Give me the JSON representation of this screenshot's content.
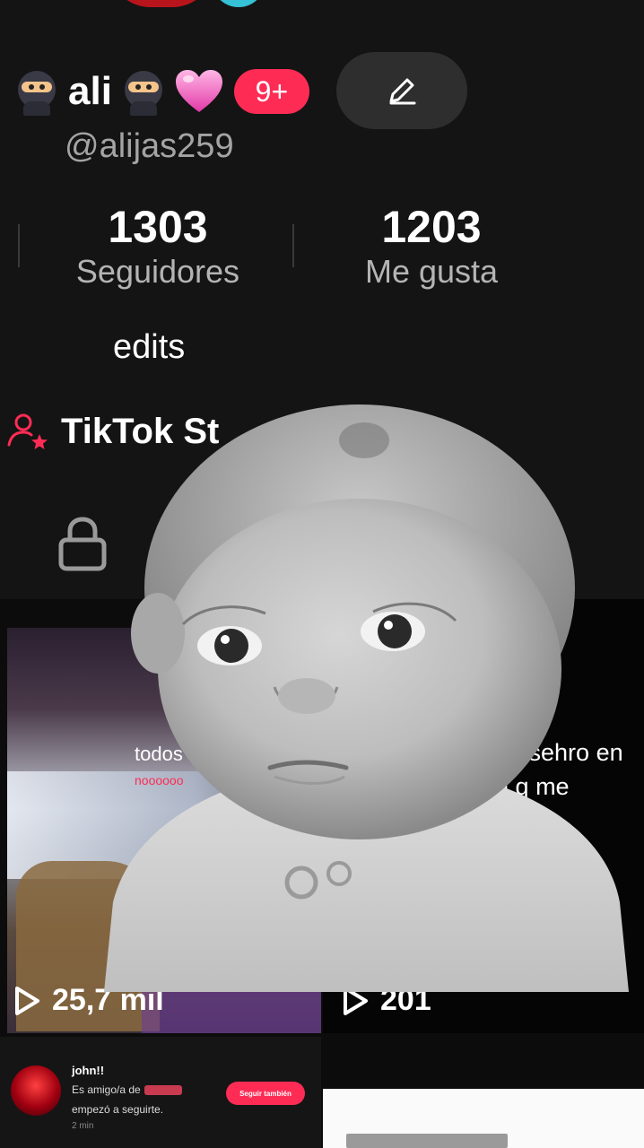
{
  "profile": {
    "name": "ali",
    "notification_count": "9+",
    "username": "@alijas259",
    "bio": "edits",
    "studio_label": "TikTok St"
  },
  "stats": [
    {
      "value": "1303",
      "label": "Seguidores"
    },
    {
      "value": "1203",
      "label": "Me gusta"
    }
  ],
  "videos": [
    {
      "overlay_text": "todos",
      "overlay_sub": "noooooo",
      "views": "25,7 mil"
    },
    {
      "overlay_text": "soy rusehro en\nuien q me\nro",
      "views": "201"
    }
  ],
  "notification": {
    "user": "john!!",
    "line1": "Es amigo/a de",
    "line2": "empezó a seguirte.",
    "time": "2 min",
    "button_label": "Seguir también"
  },
  "colors": {
    "background": "#141414",
    "accent": "#fe2c55",
    "secondary_text": "#a4a4a4"
  },
  "icons": [
    "ninja-emoji-icon",
    "pink-heart-icon",
    "pencil-icon",
    "studio-person-star-icon",
    "lock-icon",
    "heart-outline-icon",
    "play-icon"
  ]
}
